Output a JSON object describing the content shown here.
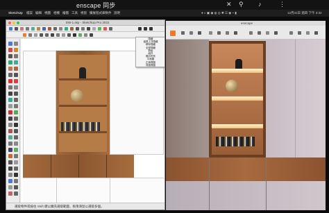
{
  "search": {
    "text": "enscape 同步"
  },
  "menubar": {
    "app": "SketchUp",
    "menus": [
      "檔案",
      "編輯",
      "視圖",
      "相機",
      "繪圖",
      "工具",
      "視窗",
      "擴展程式庫軟件",
      "說明"
    ],
    "clock": "12月31日 週四 下午 3:32"
  },
  "sketchup": {
    "title": "EW-1.skp - SketchUp Pro 2022",
    "status": "選取物件或按住 Shift 鍵以擴充選取範圍，拖曳滑鼠以選取多個。",
    "context_menu": [
      "隱藏",
      "還原上次隱藏",
      "移除隱藏",
      "全部隱藏",
      "群組",
      "組件",
      "顯示所有",
      "平面圖",
      "正面視圖",
      "背面視圖",
      "尺寸"
    ]
  },
  "enscape": {
    "title": "enscape"
  },
  "colors": {
    "accent": "#f07a2a",
    "wood": "#8b5630",
    "bg": "#0b0b0b"
  }
}
